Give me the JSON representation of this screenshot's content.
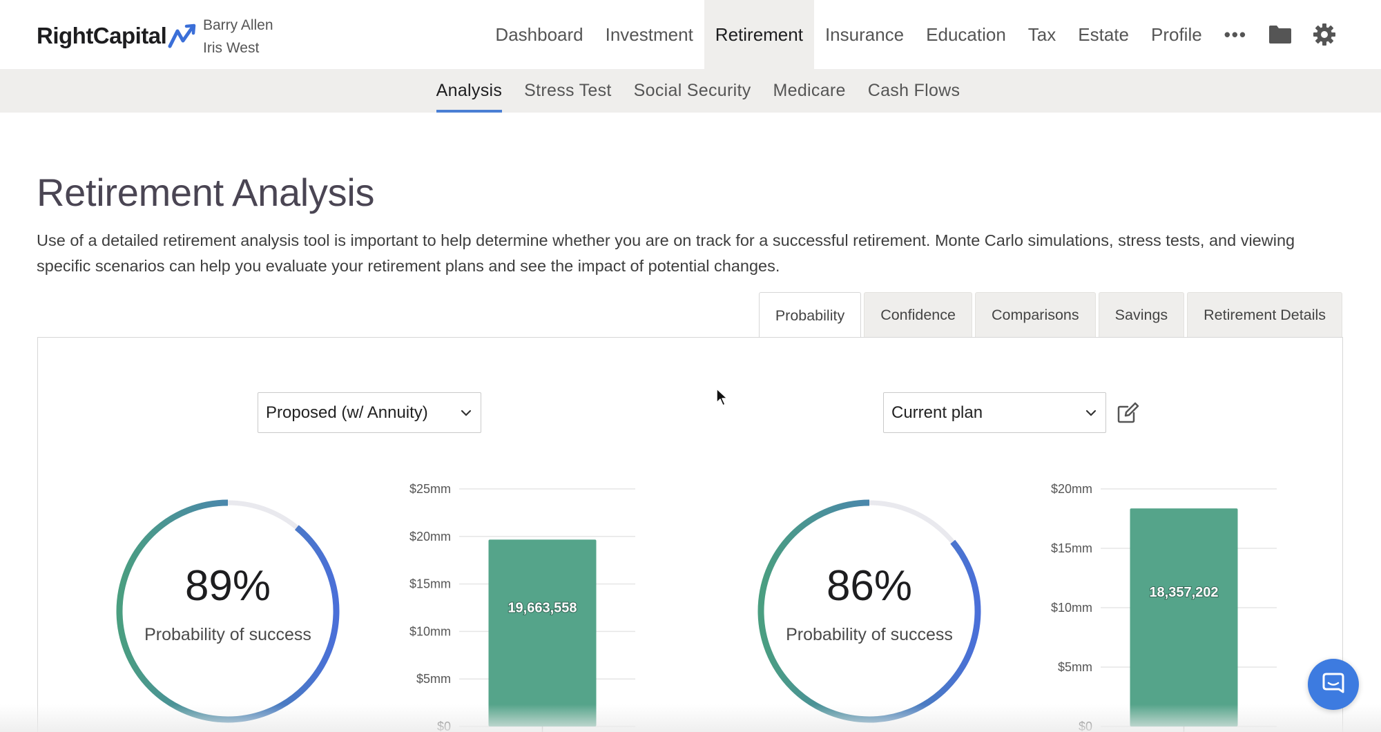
{
  "brand": {
    "name": "RightCapital",
    "accent": "#4a7fd4"
  },
  "clients": [
    "Barry Allen",
    "Iris West"
  ],
  "main_nav": {
    "items": [
      "Dashboard",
      "Investment",
      "Retirement",
      "Insurance",
      "Education",
      "Tax",
      "Estate",
      "Profile"
    ],
    "active": "Retirement",
    "more_label": "•••",
    "icons": [
      "folder-icon",
      "gear-icon"
    ]
  },
  "sub_nav": {
    "items": [
      "Analysis",
      "Stress Test",
      "Social Security",
      "Medicare",
      "Cash Flows"
    ],
    "active": "Analysis"
  },
  "page": {
    "title": "Retirement Analysis",
    "description": "Use of a detailed retirement analysis tool is important to help determine whether you are on track for a successful retirement. Monte Carlo simulations, stress tests, and viewing specific scenarios can help you evaluate your retirement plans and see the impact of potential changes."
  },
  "tabs": {
    "items": [
      "Probability",
      "Confidence",
      "Comparisons",
      "Savings",
      "Retirement Details"
    ],
    "active": "Probability"
  },
  "scenarios": {
    "left": {
      "selected": "Proposed (w/ Annuity)",
      "probability_pct": "89%",
      "probability_value": 89,
      "probability_label": "Probability of success",
      "bar_value_label": "19,663,558"
    },
    "right": {
      "selected": "Current plan",
      "probability_pct": "86%",
      "probability_value": 86,
      "probability_label": "Probability of success",
      "bar_value_label": "18,357,202",
      "edit_icon": "edit-icon"
    }
  },
  "colors": {
    "donut_gradient_top": "#4a6fd8",
    "donut_gradient_bottom": "#4a9e80",
    "donut_track": "#e9e9ee",
    "bar": "#55a48a",
    "chat": "#3d7be0"
  },
  "chart_data": [
    {
      "type": "bar",
      "categories": [
        ""
      ],
      "values": [
        19663558
      ],
      "data_labels": [
        "19,663,558"
      ],
      "yticks": [
        "$0",
        "$5mm",
        "$10mm",
        "$15mm",
        "$20mm",
        "$25mm"
      ],
      "ylim": [
        0,
        25000000
      ],
      "grid": true
    },
    {
      "type": "bar",
      "categories": [
        ""
      ],
      "values": [
        18357202
      ],
      "data_labels": [
        "18,357,202"
      ],
      "yticks": [
        "$0",
        "$5mm",
        "$10mm",
        "$15mm",
        "$20mm"
      ],
      "ylim": [
        0,
        20000000
      ],
      "grid": true
    }
  ]
}
